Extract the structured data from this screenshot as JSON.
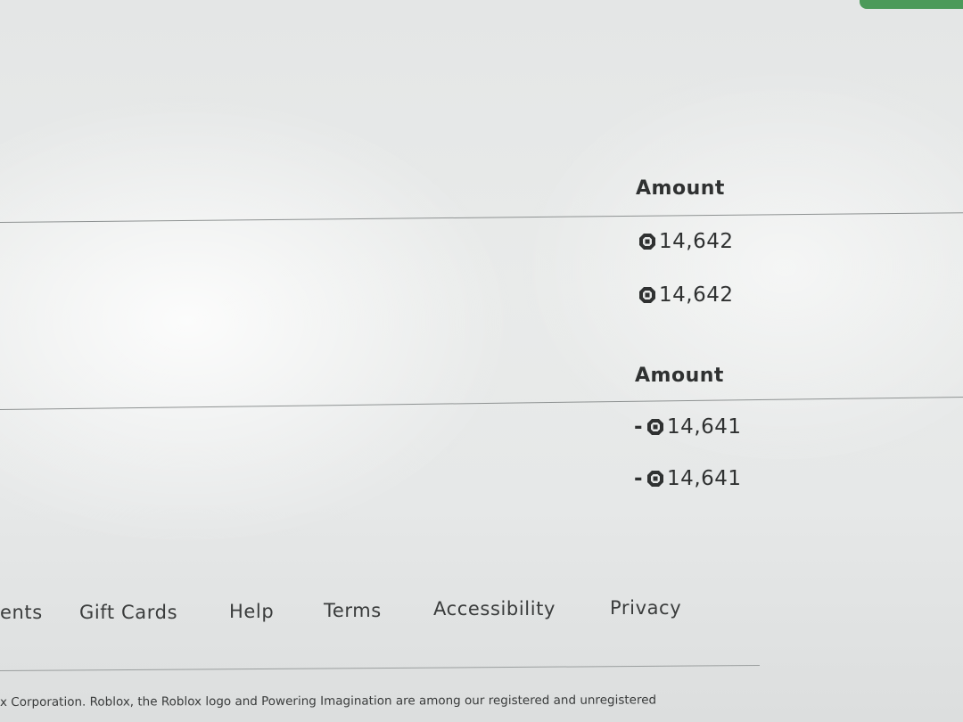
{
  "earnings_table": {
    "header_amount": "Amount",
    "rows": [
      {
        "amount": "14,642"
      },
      {
        "amount": "14,642"
      }
    ]
  },
  "spending_table": {
    "header_amount": "Amount",
    "rows": [
      {
        "sign": "-",
        "amount": "14,641"
      },
      {
        "sign": "-",
        "amount": "14,641"
      }
    ]
  },
  "currency_icon": "robux-icon",
  "footer": {
    "links": [
      {
        "label": "ents"
      },
      {
        "label": "Gift Cards"
      },
      {
        "label": "Help"
      },
      {
        "label": "Terms"
      },
      {
        "label": "Accessibility"
      },
      {
        "label": "Privacy"
      }
    ],
    "copyright": "x Corporation. Roblox, the Roblox logo and Powering Imagination are among our registered and unregistered"
  },
  "colors": {
    "accent": "#4c9a5a",
    "text": "#2f3131",
    "divider": "#8e9292"
  }
}
